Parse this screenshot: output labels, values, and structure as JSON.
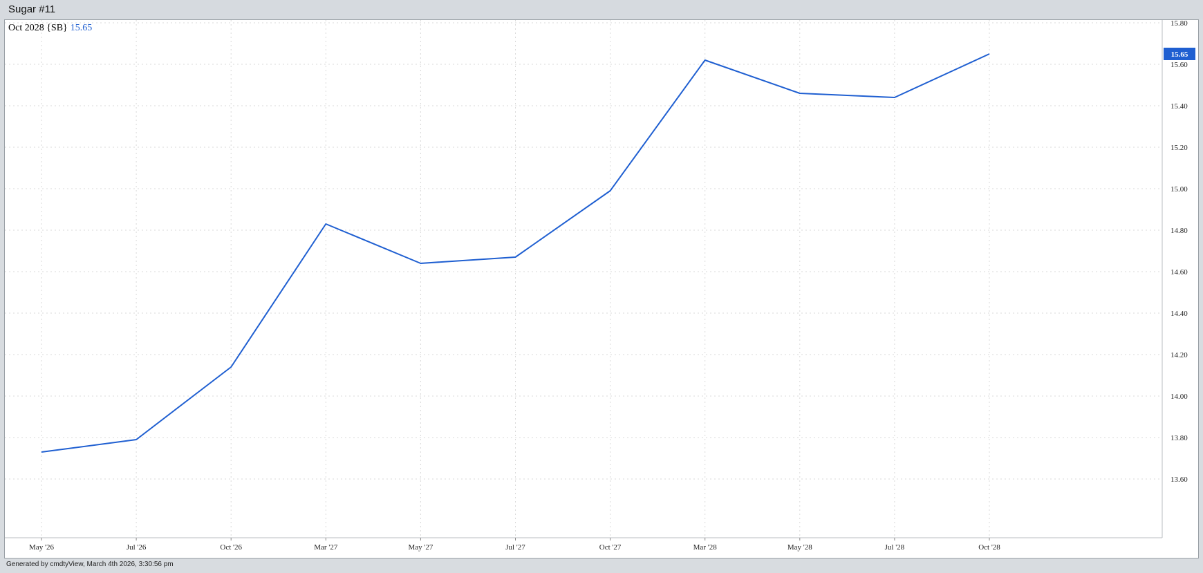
{
  "window": {
    "title": "Sugar #11"
  },
  "footer": {
    "text": "Generated by cmdtyView, March 4th 2026, 3:30:56 pm"
  },
  "legend": {
    "label": "Oct 2028 {SB}",
    "value": "15.65"
  },
  "colors": {
    "line": "#1f5fd1",
    "grid": "#d9d9d9",
    "badge": "#1f5fd1"
  },
  "chart_data": {
    "type": "line",
    "categories": [
      "May '26",
      "Jul '26",
      "Oct '26",
      "Mar '27",
      "May '27",
      "Jul '27",
      "Oct '27",
      "Mar '28",
      "May '28",
      "Jul '28",
      "Oct '28"
    ],
    "series": [
      {
        "values": [
          13.73,
          13.79,
          14.14,
          14.83,
          14.64,
          14.67,
          14.99,
          15.62,
          15.46,
          15.44,
          15.65
        ]
      }
    ],
    "ylim": [
      13.6,
      15.8
    ],
    "yticks": [
      "13.60",
      "13.80",
      "14.00",
      "14.20",
      "14.40",
      "14.60",
      "14.80",
      "15.00",
      "15.20",
      "15.40",
      "15.60",
      "15.80"
    ],
    "last_value_label": "15.65",
    "grid": true,
    "axis_side": "right"
  }
}
